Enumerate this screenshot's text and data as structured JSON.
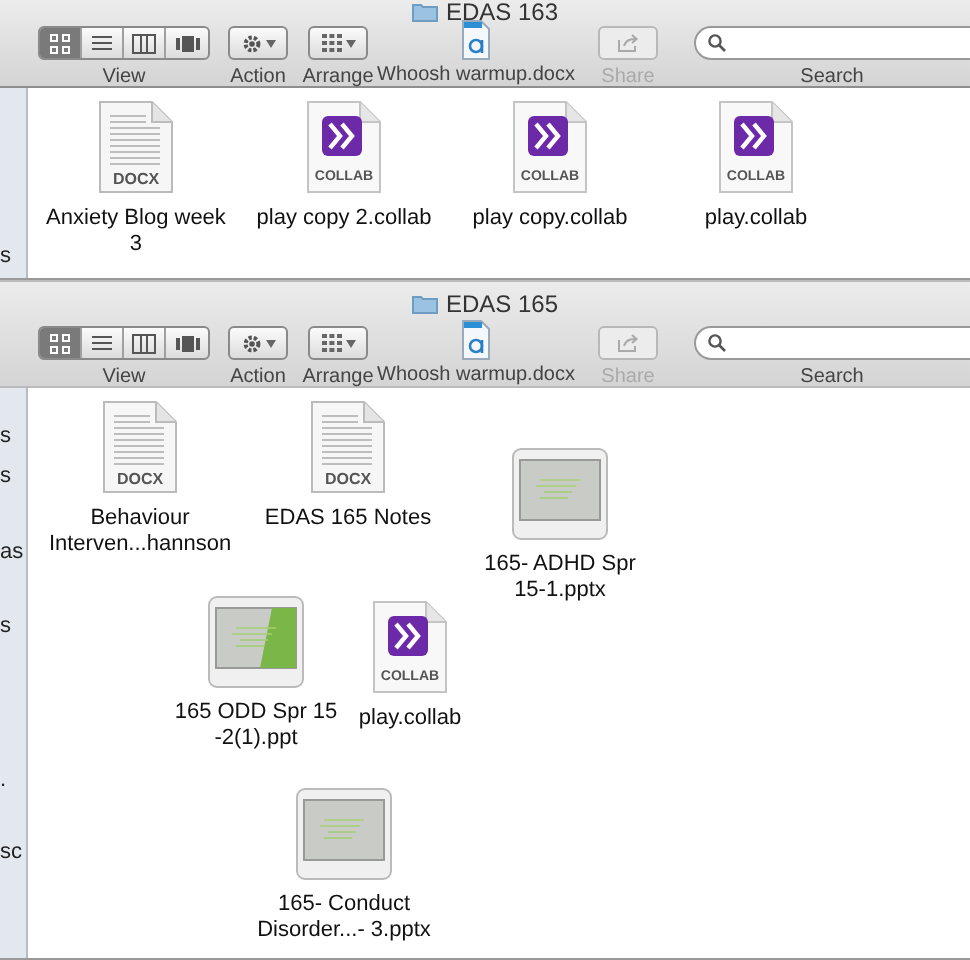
{
  "windows": [
    {
      "title": "EDAS 163",
      "toolbar": {
        "view_modes": [
          {
            "kind": "icons",
            "selected": true
          },
          {
            "kind": "list",
            "selected": false
          },
          {
            "kind": "columns",
            "selected": false
          },
          {
            "kind": "coverflow",
            "selected": false
          }
        ],
        "view_label": "View",
        "action_label": "Action",
        "arrange_label": "Arrange",
        "document_label": "Whoosh warmup.docx",
        "share": {
          "label": "Share",
          "disabled": true
        },
        "search_label": "Search"
      },
      "sidebar": [
        {
          "text": "s"
        }
      ],
      "files": [
        {
          "kind": "docx",
          "badge": "DOCX",
          "name": [
            "Anxiety Blog week",
            "3"
          ]
        },
        {
          "kind": "collab",
          "badge": "COLLAB",
          "name": [
            "play copy 2.collab"
          ]
        },
        {
          "kind": "collab",
          "badge": "COLLAB",
          "name": [
            "play copy.collab"
          ]
        },
        {
          "kind": "collab",
          "badge": "COLLAB",
          "name": [
            "play.collab"
          ]
        }
      ]
    },
    {
      "title": "EDAS 165",
      "toolbar": {
        "view_modes": [
          {
            "kind": "icons",
            "selected": true
          },
          {
            "kind": "list",
            "selected": false
          },
          {
            "kind": "columns",
            "selected": false
          },
          {
            "kind": "coverflow",
            "selected": false
          }
        ],
        "view_label": "View",
        "action_label": "Action",
        "arrange_label": "Arrange",
        "document_label": "Whoosh warmup.docx",
        "share": {
          "label": "Share",
          "disabled": true
        },
        "search_label": "Search"
      },
      "sidebar": [
        {
          "text": "s"
        },
        {
          "text": "s"
        },
        {
          "text": "as"
        },
        {
          "text": "s"
        },
        {
          "text": "."
        },
        {
          "text": "sc"
        }
      ],
      "files": [
        {
          "kind": "docx",
          "badge": "DOCX",
          "name": [
            "Behaviour",
            "Interven...hannson"
          ]
        },
        {
          "kind": "docx",
          "badge": "DOCX",
          "name": [
            "EDAS 165 Notes"
          ]
        },
        {
          "kind": "slides",
          "name": [
            "165- ADHD Spr",
            "15-1.pptx"
          ]
        },
        {
          "kind": "slides_green",
          "name": [
            "165 ODD Spr 15",
            "-2(1).ppt"
          ]
        },
        {
          "kind": "collab",
          "badge": "COLLAB",
          "name": [
            "play.collab"
          ]
        },
        {
          "kind": "slides",
          "name": [
            "165- Conduct",
            "Disorder...- 3.pptx"
          ]
        }
      ]
    }
  ]
}
